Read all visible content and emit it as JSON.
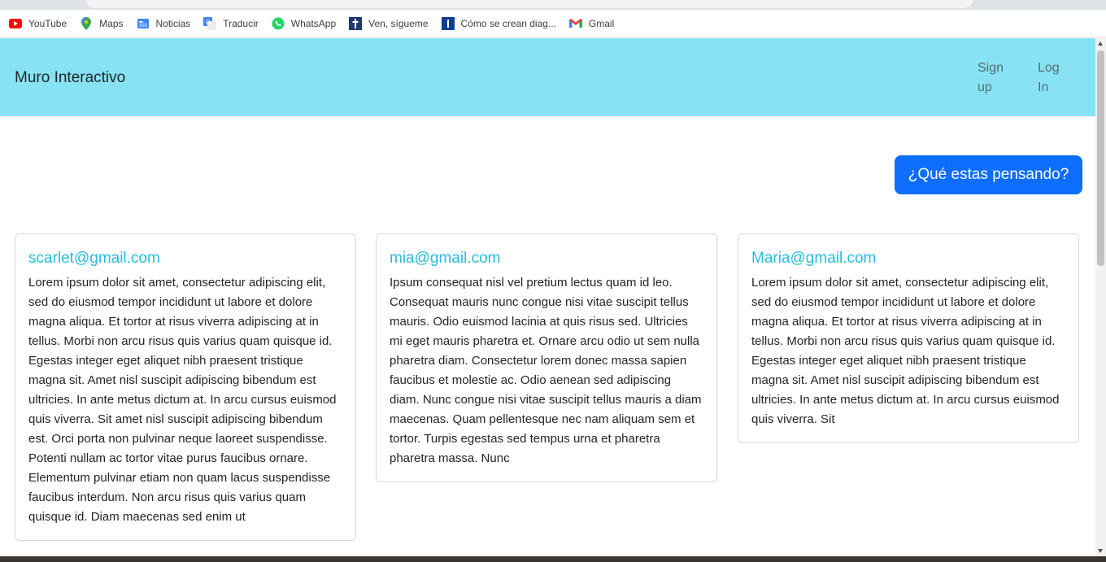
{
  "bookmarks": [
    {
      "label": "YouTube",
      "icon": "youtube-icon",
      "color": "#ff0000"
    },
    {
      "label": "Maps",
      "icon": "maps-pin-icon",
      "color": "#34a853"
    },
    {
      "label": "Noticias",
      "icon": "google-news-icon",
      "color": "#4285f4"
    },
    {
      "label": "Traducir",
      "icon": "google-translate-icon",
      "color": "#4285f4"
    },
    {
      "label": "WhatsApp",
      "icon": "whatsapp-icon",
      "color": "#25d366"
    },
    {
      "label": "Ven, sígueme",
      "icon": "church-icon",
      "color": "#1c3a6e"
    },
    {
      "label": "Cómo se crean diag...",
      "icon": "bookmark-page-icon",
      "color": "#0b3d91"
    },
    {
      "label": "Gmail",
      "icon": "gmail-icon",
      "color": "#ea4335"
    }
  ],
  "navbar": {
    "brand": "Muro Interactivo",
    "signup": {
      "line1": "Sign",
      "line2": "up"
    },
    "login": {
      "line1": "Log",
      "line2": "In"
    },
    "background": "#87e3f4"
  },
  "cta": {
    "label": "¿Qué estas pensando?",
    "color": "#0d6efd"
  },
  "posts": [
    {
      "author": "scarlet@gmail.com",
      "body": "Lorem ipsum dolor sit amet, consectetur adipiscing elit, sed do eiusmod tempor incididunt ut labore et dolore magna aliqua. Et tortor at risus viverra adipiscing at in tellus. Morbi non arcu risus quis varius quam quisque id. Egestas integer eget aliquet nibh praesent tristique magna sit. Amet nisl suscipit adipiscing bibendum est ultricies. In ante metus dictum at. In arcu cursus euismod quis viverra. Sit amet nisl suscipit adipiscing bibendum est. Orci porta non pulvinar neque laoreet suspendisse. Potenti nullam ac tortor vitae purus faucibus ornare. Elementum pulvinar etiam non quam lacus suspendisse faucibus interdum. Non arcu risus quis varius quam quisque id. Diam maecenas sed enim ut"
    },
    {
      "author": "mia@gmail.com",
      "body": "Ipsum consequat nisl vel pretium lectus quam id leo. Consequat mauris nunc congue nisi vitae suscipit tellus mauris. Odio euismod lacinia at quis risus sed. Ultricies mi eget mauris pharetra et. Ornare arcu odio ut sem nulla pharetra diam. Consectetur lorem donec massa sapien faucibus et molestie ac. Odio aenean sed adipiscing diam. Nunc congue nisi vitae suscipit tellus mauris a diam maecenas. Quam pellentesque nec nam aliquam sem et tortor. Turpis egestas sed tempus urna et pharetra pharetra massa. Nunc"
    },
    {
      "author": "Maria@gmail.com",
      "body": "Lorem ipsum dolor sit amet, consectetur adipiscing elit, sed do eiusmod tempor incididunt ut labore et dolore magna aliqua. Et tortor at risus viverra adipiscing at in tellus. Morbi non arcu risus quis varius quam quisque id. Egestas integer eget aliquet nibh praesent tristique magna sit. Amet nisl suscipit adipiscing bibendum est ultricies. In ante metus dictum at. In arcu cursus euismod quis viverra. Sit"
    }
  ],
  "accent_color": "#27bddc"
}
